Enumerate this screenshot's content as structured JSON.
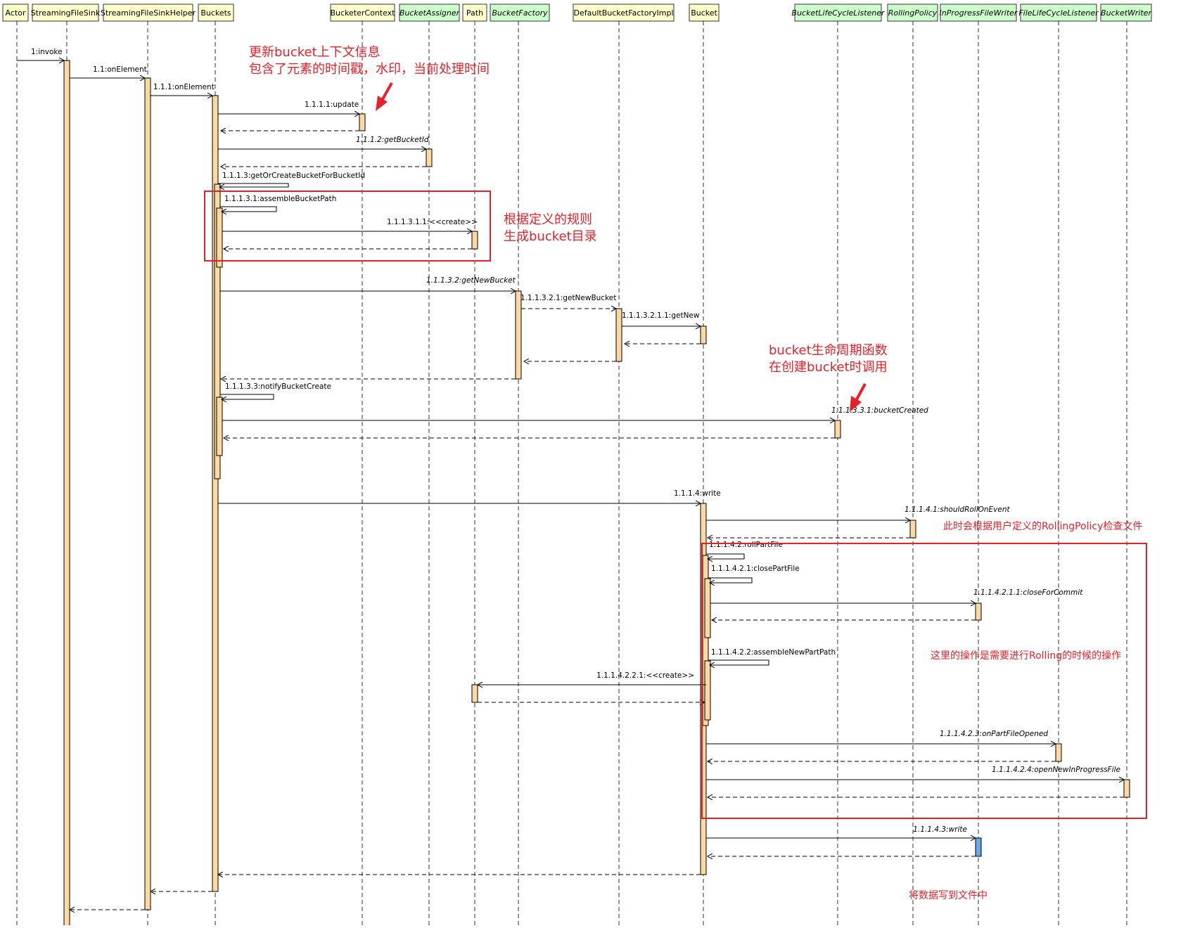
{
  "participants": [
    {
      "id": "actor",
      "label": "Actor",
      "interface": false
    },
    {
      "id": "sfs",
      "label": "StreamingFileSink",
      "interface": false
    },
    {
      "id": "sfsh",
      "label": "StreamingFileSinkHelper",
      "interface": false
    },
    {
      "id": "buckets",
      "label": "Buckets",
      "interface": false
    },
    {
      "id": "bctx",
      "label": "BucketerContext",
      "interface": false
    },
    {
      "id": "bassign",
      "label": "BucketAssigner",
      "interface": true
    },
    {
      "id": "path",
      "label": "Path",
      "interface": false
    },
    {
      "id": "bfactory",
      "label": "BucketFactory",
      "interface": true
    },
    {
      "id": "dbfi",
      "label": "DefaultBucketFactoryImpl",
      "interface": false
    },
    {
      "id": "bucket",
      "label": "Bucket",
      "interface": false
    },
    {
      "id": "blcl",
      "label": "BucketLifeCycleListener",
      "interface": true
    },
    {
      "id": "rpol",
      "label": "RollingPolicy",
      "interface": true
    },
    {
      "id": "ipfw",
      "label": "InProgressFileWriter",
      "interface": true
    },
    {
      "id": "flcl",
      "label": "FileLifeCycleListener",
      "interface": true
    },
    {
      "id": "bw",
      "label": "BucketWriter",
      "interface": true
    }
  ],
  "messages": [
    {
      "label": "1:invoke",
      "italic": false
    },
    {
      "label": "1.1:onElement",
      "italic": false
    },
    {
      "label": "1.1.1:onElement",
      "italic": false
    },
    {
      "label": "1.1.1.1:update",
      "italic": false
    },
    {
      "label": "1.1.1.2:getBucketId",
      "italic": true
    },
    {
      "label": "1.1.1.3:getOrCreateBucketForBucketId",
      "italic": false
    },
    {
      "label": "1.1.1.3.1:assembleBucketPath",
      "italic": false
    },
    {
      "label": "1.1.1.3.1.1:<<create>>",
      "italic": false
    },
    {
      "label": "1.1.1.3.2:getNewBucket",
      "italic": true
    },
    {
      "label": "1.1.1.3.2.1:getNewBucket",
      "italic": false
    },
    {
      "label": "1.1.1.3.2.1.1:getNew",
      "italic": false
    },
    {
      "label": "1.1.1.3.3:notifyBucketCreate",
      "italic": false
    },
    {
      "label": "1.1.1.3.3.1:bucketCreated",
      "italic": true
    },
    {
      "label": "1.1.1.4:write",
      "italic": false
    },
    {
      "label": "1.1.1.4.1:shouldRollOnEvent",
      "italic": true
    },
    {
      "label": "1.1.1.4.2:rollPartFile",
      "italic": false
    },
    {
      "label": "1.1.1.4.2.1:closePartFile",
      "italic": false
    },
    {
      "label": "1.1.1.4.2.1.1:closeForCommit",
      "italic": true
    },
    {
      "label": "1.1.1.4.2.2:assembleNewPartPath",
      "italic": false
    },
    {
      "label": "1.1.1.4.2.2.1:<<create>>",
      "italic": false
    },
    {
      "label": "1.1.1.4.2.3:onPartFileOpened",
      "italic": true
    },
    {
      "label": "1.1.1.4.2.4:openNewInProgressFile",
      "italic": true
    },
    {
      "label": "1.1.1.4.3:write",
      "italic": true
    }
  ],
  "notes": {
    "update_line1": "更新bucket上下文信息",
    "update_line2": "包含了元素的时间戳，水印，当前处理时间",
    "path_line1": "根据定义的规则",
    "path_line2": "生成bucket目录",
    "lifecycle_line1": "bucket生命周期函数",
    "lifecycle_line2": "在创建bucket时调用",
    "rolling_policy": "此时会根据用户定义的RollingPolicy检查文件",
    "rolling_ops": "这里的操作是需要进行Rolling的时候的操作",
    "write_data": "将数据写到文件中"
  },
  "colors": {
    "participant_fill": "#ffffcc",
    "interface_fill": "#ccffcc",
    "activation_fill": "#fcd9a2",
    "write_activation_fill": "#66aaee",
    "annotation": "#e8202a"
  }
}
